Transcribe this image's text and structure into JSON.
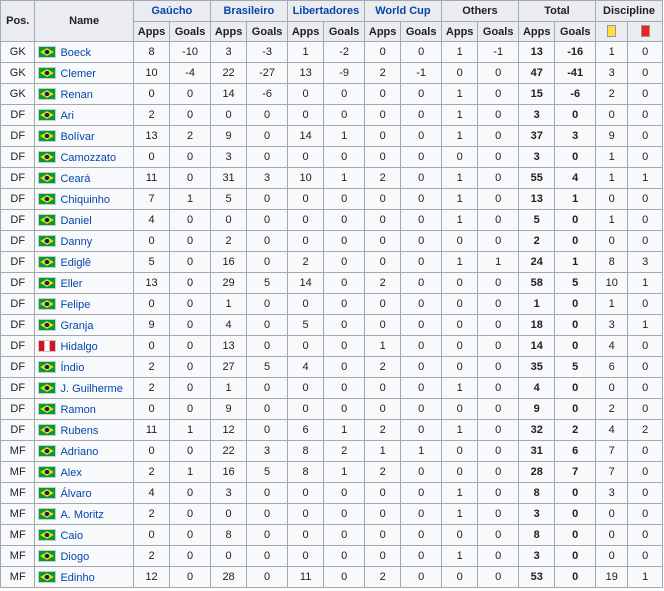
{
  "headers": {
    "pos": "Pos.",
    "name": "Name",
    "groups": [
      {
        "label": "Gaúcho",
        "linked": true
      },
      {
        "label": "Brasileiro",
        "linked": true
      },
      {
        "label": "Libertadores",
        "linked": true
      },
      {
        "label": "World Cup",
        "linked": true
      },
      {
        "label": "Others",
        "linked": false
      },
      {
        "label": "Total",
        "linked": false
      },
      {
        "label": "Discipline",
        "linked": false
      }
    ],
    "apps": "Apps",
    "goals": "Goals",
    "yellow_card_icon": "yellow-card-icon",
    "red_card_icon": "red-card-icon"
  },
  "colors": {
    "yellow_card": "#ffdd44",
    "red_card": "#ee2222",
    "link": "#0645ad",
    "header_bg": "#eaecf0",
    "cell_bg": "#f8f9fa",
    "border": "#a2a9b1"
  },
  "players": [
    {
      "pos": "GK",
      "name": "Boeck",
      "flag": "brazil-flag-icon",
      "stats": [
        "8",
        "-10",
        "3",
        "-3",
        "1",
        "-2",
        "0",
        "0",
        "1",
        "-1",
        "13",
        "-16",
        "1",
        "0"
      ]
    },
    {
      "pos": "GK",
      "name": "Clemer",
      "flag": "brazil-flag-icon",
      "stats": [
        "10",
        "-4",
        "22",
        "-27",
        "13",
        "-9",
        "2",
        "-1",
        "0",
        "0",
        "47",
        "-41",
        "3",
        "0"
      ]
    },
    {
      "pos": "GK",
      "name": "Renan",
      "flag": "brazil-flag-icon",
      "stats": [
        "0",
        "0",
        "14",
        "-6",
        "0",
        "0",
        "0",
        "0",
        "1",
        "0",
        "15",
        "-6",
        "2",
        "0"
      ]
    },
    {
      "pos": "DF",
      "name": "Ari",
      "flag": "brazil-flag-icon",
      "stats": [
        "2",
        "0",
        "0",
        "0",
        "0",
        "0",
        "0",
        "0",
        "1",
        "0",
        "3",
        "0",
        "0",
        "0"
      ]
    },
    {
      "pos": "DF",
      "name": "Bolívar",
      "flag": "brazil-flag-icon",
      "stats": [
        "13",
        "2",
        "9",
        "0",
        "14",
        "1",
        "0",
        "0",
        "1",
        "0",
        "37",
        "3",
        "9",
        "0"
      ]
    },
    {
      "pos": "DF",
      "name": "Camozzato",
      "flag": "brazil-flag-icon",
      "stats": [
        "0",
        "0",
        "3",
        "0",
        "0",
        "0",
        "0",
        "0",
        "0",
        "0",
        "3",
        "0",
        "1",
        "0"
      ]
    },
    {
      "pos": "DF",
      "name": "Ceará",
      "flag": "brazil-flag-icon",
      "stats": [
        "11",
        "0",
        "31",
        "3",
        "10",
        "1",
        "2",
        "0",
        "1",
        "0",
        "55",
        "4",
        "1",
        "1"
      ]
    },
    {
      "pos": "DF",
      "name": "Chiquinho",
      "flag": "brazil-flag-icon",
      "stats": [
        "7",
        "1",
        "5",
        "0",
        "0",
        "0",
        "0",
        "0",
        "1",
        "0",
        "13",
        "1",
        "0",
        "0"
      ]
    },
    {
      "pos": "DF",
      "name": "Daniel",
      "flag": "brazil-flag-icon",
      "stats": [
        "4",
        "0",
        "0",
        "0",
        "0",
        "0",
        "0",
        "0",
        "1",
        "0",
        "5",
        "0",
        "1",
        "0"
      ]
    },
    {
      "pos": "DF",
      "name": "Danny",
      "flag": "brazil-flag-icon",
      "stats": [
        "0",
        "0",
        "2",
        "0",
        "0",
        "0",
        "0",
        "0",
        "0",
        "0",
        "2",
        "0",
        "0",
        "0"
      ]
    },
    {
      "pos": "DF",
      "name": "Ediglê",
      "flag": "brazil-flag-icon",
      "stats": [
        "5",
        "0",
        "16",
        "0",
        "2",
        "0",
        "0",
        "0",
        "1",
        "1",
        "24",
        "1",
        "8",
        "3"
      ]
    },
    {
      "pos": "DF",
      "name": "Eller",
      "flag": "brazil-flag-icon",
      "stats": [
        "13",
        "0",
        "29",
        "5",
        "14",
        "0",
        "2",
        "0",
        "0",
        "0",
        "58",
        "5",
        "10",
        "1"
      ]
    },
    {
      "pos": "DF",
      "name": "Felipe",
      "flag": "brazil-flag-icon",
      "stats": [
        "0",
        "0",
        "1",
        "0",
        "0",
        "0",
        "0",
        "0",
        "0",
        "0",
        "1",
        "0",
        "1",
        "0"
      ]
    },
    {
      "pos": "DF",
      "name": "Granja",
      "flag": "brazil-flag-icon",
      "stats": [
        "9",
        "0",
        "4",
        "0",
        "5",
        "0",
        "0",
        "0",
        "0",
        "0",
        "18",
        "0",
        "3",
        "1"
      ]
    },
    {
      "pos": "DF",
      "name": "Hidalgo",
      "flag": "peru-flag-icon",
      "stats": [
        "0",
        "0",
        "13",
        "0",
        "0",
        "0",
        "1",
        "0",
        "0",
        "0",
        "14",
        "0",
        "4",
        "0"
      ]
    },
    {
      "pos": "DF",
      "name": "Índio",
      "flag": "brazil-flag-icon",
      "stats": [
        "2",
        "0",
        "27",
        "5",
        "4",
        "0",
        "2",
        "0",
        "0",
        "0",
        "35",
        "5",
        "6",
        "0"
      ]
    },
    {
      "pos": "DF",
      "name": "J. Guilherme",
      "flag": "brazil-flag-icon",
      "stats": [
        "2",
        "0",
        "1",
        "0",
        "0",
        "0",
        "0",
        "0",
        "1",
        "0",
        "4",
        "0",
        "0",
        "0"
      ]
    },
    {
      "pos": "DF",
      "name": "Ramon",
      "flag": "brazil-flag-icon",
      "stats": [
        "0",
        "0",
        "9",
        "0",
        "0",
        "0",
        "0",
        "0",
        "0",
        "0",
        "9",
        "0",
        "2",
        "0"
      ]
    },
    {
      "pos": "DF",
      "name": "Rubens",
      "flag": "brazil-flag-icon",
      "stats": [
        "11",
        "1",
        "12",
        "0",
        "6",
        "1",
        "2",
        "0",
        "1",
        "0",
        "32",
        "2",
        "4",
        "2"
      ]
    },
    {
      "pos": "MF",
      "name": "Adriano",
      "flag": "brazil-flag-icon",
      "stats": [
        "0",
        "0",
        "22",
        "3",
        "8",
        "2",
        "1",
        "1",
        "0",
        "0",
        "31",
        "6",
        "7",
        "0"
      ]
    },
    {
      "pos": "MF",
      "name": "Alex",
      "flag": "brazil-flag-icon",
      "stats": [
        "2",
        "1",
        "16",
        "5",
        "8",
        "1",
        "2",
        "0",
        "0",
        "0",
        "28",
        "7",
        "7",
        "0"
      ]
    },
    {
      "pos": "MF",
      "name": "Álvaro",
      "flag": "brazil-flag-icon",
      "stats": [
        "4",
        "0",
        "3",
        "0",
        "0",
        "0",
        "0",
        "0",
        "1",
        "0",
        "8",
        "0",
        "3",
        "0"
      ]
    },
    {
      "pos": "MF",
      "name": "A. Moritz",
      "flag": "brazil-flag-icon",
      "stats": [
        "2",
        "0",
        "0",
        "0",
        "0",
        "0",
        "0",
        "0",
        "1",
        "0",
        "3",
        "0",
        "0",
        "0"
      ]
    },
    {
      "pos": "MF",
      "name": "Caio",
      "flag": "brazil-flag-icon",
      "stats": [
        "0",
        "0",
        "8",
        "0",
        "0",
        "0",
        "0",
        "0",
        "0",
        "0",
        "8",
        "0",
        "0",
        "0"
      ]
    },
    {
      "pos": "MF",
      "name": "Diogo",
      "flag": "brazil-flag-icon",
      "stats": [
        "2",
        "0",
        "0",
        "0",
        "0",
        "0",
        "0",
        "0",
        "1",
        "0",
        "3",
        "0",
        "0",
        "0"
      ]
    },
    {
      "pos": "MF",
      "name": "Edinho",
      "flag": "brazil-flag-icon",
      "stats": [
        "12",
        "0",
        "28",
        "0",
        "11",
        "0",
        "2",
        "0",
        "0",
        "0",
        "53",
        "0",
        "19",
        "1"
      ]
    }
  ]
}
